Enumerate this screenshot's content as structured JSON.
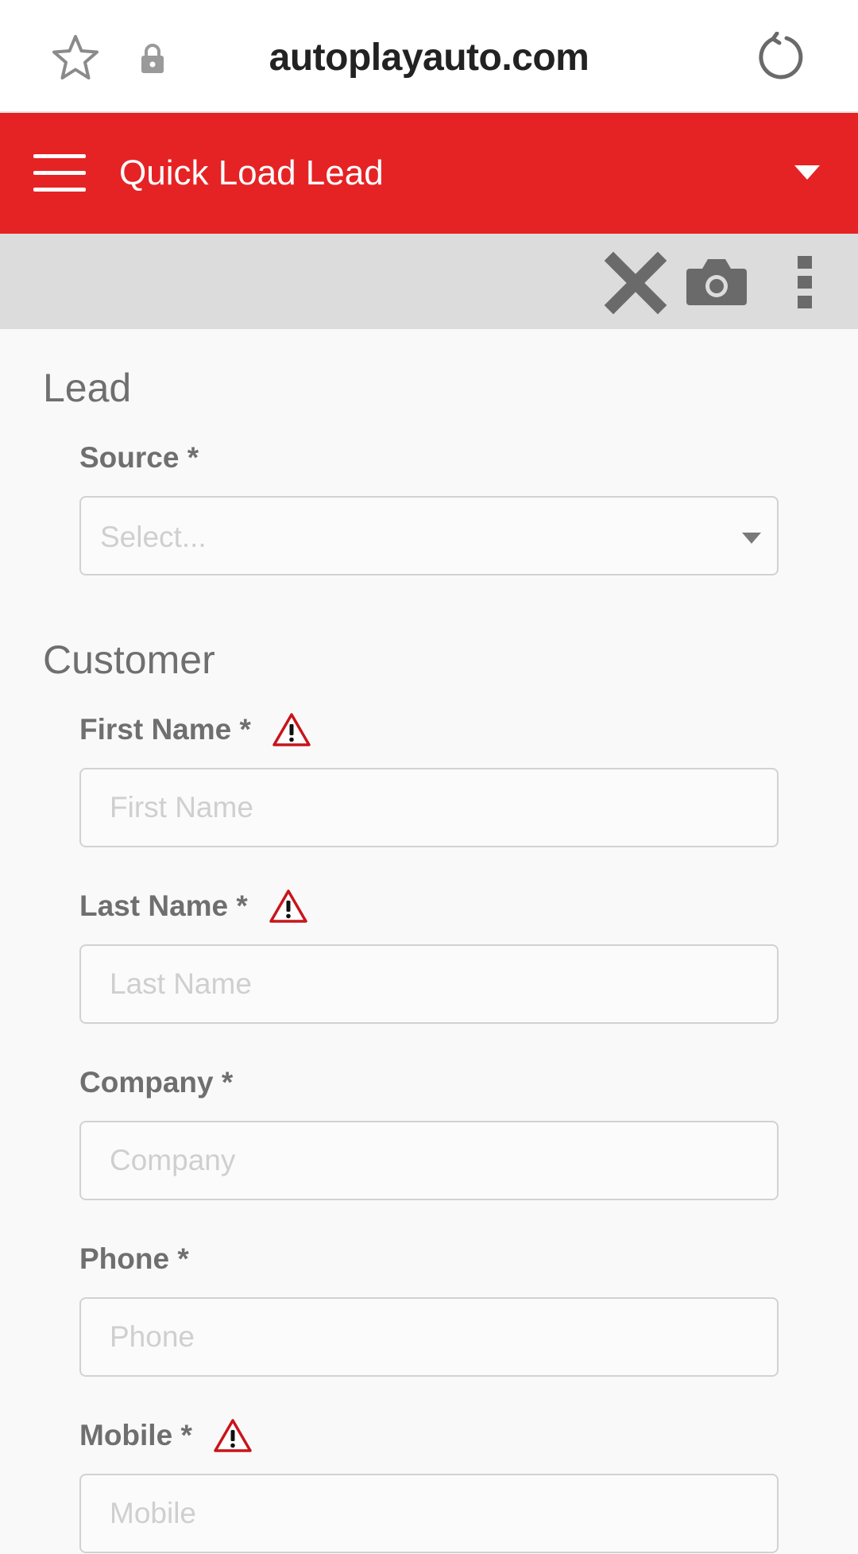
{
  "browser": {
    "url": "autoplayauto.com",
    "icons": {
      "bookmark": "star-icon",
      "secure": "lock-icon",
      "reload": "reload-icon"
    }
  },
  "header": {
    "title": "Quick Load Lead",
    "accent_color": "#e52325",
    "icons": {
      "menu": "hamburger-menu-icon",
      "dropdown": "caret-down-icon"
    }
  },
  "toolbar": {
    "icons": [
      "close-icon",
      "camera-icon",
      "more-vertical-icon"
    ]
  },
  "sections": {
    "lead": {
      "title": "Lead",
      "source": {
        "label": "Source *",
        "placeholder": "Select...",
        "value": ""
      }
    },
    "customer": {
      "title": "Customer",
      "first_name": {
        "label": "First Name *",
        "placeholder": "First Name",
        "value": "",
        "warning": true
      },
      "last_name": {
        "label": "Last Name *",
        "placeholder": "Last Name",
        "value": "",
        "warning": true
      },
      "company": {
        "label": "Company *",
        "placeholder": "Company",
        "value": "",
        "warning": false
      },
      "phone": {
        "label": "Phone *",
        "placeholder": "Phone",
        "value": "",
        "warning": false
      },
      "mobile": {
        "label": "Mobile *",
        "placeholder": "Mobile",
        "value": "",
        "warning": true
      }
    }
  },
  "warning_color": "#c8151b"
}
